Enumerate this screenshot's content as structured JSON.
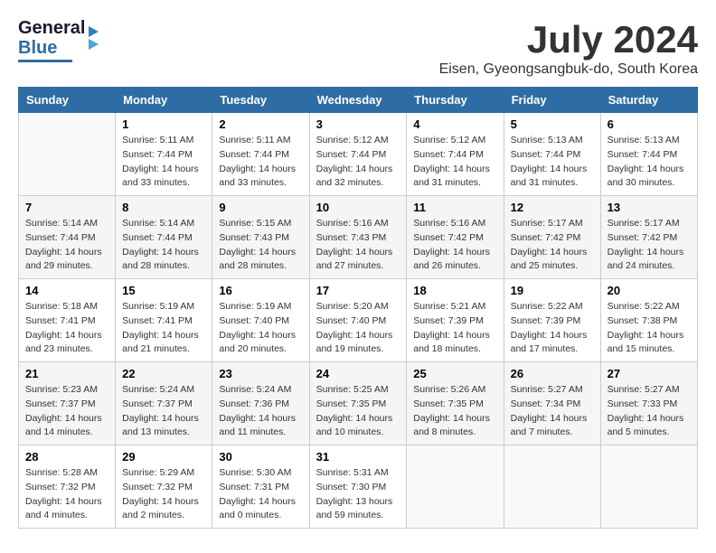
{
  "logo": {
    "line1": "General",
    "line2": "Blue"
  },
  "header": {
    "month_year": "July 2024",
    "location": "Eisen, Gyeongsangbuk-do, South Korea"
  },
  "days_of_week": [
    "Sunday",
    "Monday",
    "Tuesday",
    "Wednesday",
    "Thursday",
    "Friday",
    "Saturday"
  ],
  "weeks": [
    [
      {
        "day": "",
        "sunrise": "",
        "sunset": "",
        "daylight": ""
      },
      {
        "day": "1",
        "sunrise": "Sunrise: 5:11 AM",
        "sunset": "Sunset: 7:44 PM",
        "daylight": "Daylight: 14 hours and 33 minutes."
      },
      {
        "day": "2",
        "sunrise": "Sunrise: 5:11 AM",
        "sunset": "Sunset: 7:44 PM",
        "daylight": "Daylight: 14 hours and 33 minutes."
      },
      {
        "day": "3",
        "sunrise": "Sunrise: 5:12 AM",
        "sunset": "Sunset: 7:44 PM",
        "daylight": "Daylight: 14 hours and 32 minutes."
      },
      {
        "day": "4",
        "sunrise": "Sunrise: 5:12 AM",
        "sunset": "Sunset: 7:44 PM",
        "daylight": "Daylight: 14 hours and 31 minutes."
      },
      {
        "day": "5",
        "sunrise": "Sunrise: 5:13 AM",
        "sunset": "Sunset: 7:44 PM",
        "daylight": "Daylight: 14 hours and 31 minutes."
      },
      {
        "day": "6",
        "sunrise": "Sunrise: 5:13 AM",
        "sunset": "Sunset: 7:44 PM",
        "daylight": "Daylight: 14 hours and 30 minutes."
      }
    ],
    [
      {
        "day": "7",
        "sunrise": "Sunrise: 5:14 AM",
        "sunset": "Sunset: 7:44 PM",
        "daylight": "Daylight: 14 hours and 29 minutes."
      },
      {
        "day": "8",
        "sunrise": "Sunrise: 5:14 AM",
        "sunset": "Sunset: 7:44 PM",
        "daylight": "Daylight: 14 hours and 28 minutes."
      },
      {
        "day": "9",
        "sunrise": "Sunrise: 5:15 AM",
        "sunset": "Sunset: 7:43 PM",
        "daylight": "Daylight: 14 hours and 28 minutes."
      },
      {
        "day": "10",
        "sunrise": "Sunrise: 5:16 AM",
        "sunset": "Sunset: 7:43 PM",
        "daylight": "Daylight: 14 hours and 27 minutes."
      },
      {
        "day": "11",
        "sunrise": "Sunrise: 5:16 AM",
        "sunset": "Sunset: 7:42 PM",
        "daylight": "Daylight: 14 hours and 26 minutes."
      },
      {
        "day": "12",
        "sunrise": "Sunrise: 5:17 AM",
        "sunset": "Sunset: 7:42 PM",
        "daylight": "Daylight: 14 hours and 25 minutes."
      },
      {
        "day": "13",
        "sunrise": "Sunrise: 5:17 AM",
        "sunset": "Sunset: 7:42 PM",
        "daylight": "Daylight: 14 hours and 24 minutes."
      }
    ],
    [
      {
        "day": "14",
        "sunrise": "Sunrise: 5:18 AM",
        "sunset": "Sunset: 7:41 PM",
        "daylight": "Daylight: 14 hours and 23 minutes."
      },
      {
        "day": "15",
        "sunrise": "Sunrise: 5:19 AM",
        "sunset": "Sunset: 7:41 PM",
        "daylight": "Daylight: 14 hours and 21 minutes."
      },
      {
        "day": "16",
        "sunrise": "Sunrise: 5:19 AM",
        "sunset": "Sunset: 7:40 PM",
        "daylight": "Daylight: 14 hours and 20 minutes."
      },
      {
        "day": "17",
        "sunrise": "Sunrise: 5:20 AM",
        "sunset": "Sunset: 7:40 PM",
        "daylight": "Daylight: 14 hours and 19 minutes."
      },
      {
        "day": "18",
        "sunrise": "Sunrise: 5:21 AM",
        "sunset": "Sunset: 7:39 PM",
        "daylight": "Daylight: 14 hours and 18 minutes."
      },
      {
        "day": "19",
        "sunrise": "Sunrise: 5:22 AM",
        "sunset": "Sunset: 7:39 PM",
        "daylight": "Daylight: 14 hours and 17 minutes."
      },
      {
        "day": "20",
        "sunrise": "Sunrise: 5:22 AM",
        "sunset": "Sunset: 7:38 PM",
        "daylight": "Daylight: 14 hours and 15 minutes."
      }
    ],
    [
      {
        "day": "21",
        "sunrise": "Sunrise: 5:23 AM",
        "sunset": "Sunset: 7:37 PM",
        "daylight": "Daylight: 14 hours and 14 minutes."
      },
      {
        "day": "22",
        "sunrise": "Sunrise: 5:24 AM",
        "sunset": "Sunset: 7:37 PM",
        "daylight": "Daylight: 14 hours and 13 minutes."
      },
      {
        "day": "23",
        "sunrise": "Sunrise: 5:24 AM",
        "sunset": "Sunset: 7:36 PM",
        "daylight": "Daylight: 14 hours and 11 minutes."
      },
      {
        "day": "24",
        "sunrise": "Sunrise: 5:25 AM",
        "sunset": "Sunset: 7:35 PM",
        "daylight": "Daylight: 14 hours and 10 minutes."
      },
      {
        "day": "25",
        "sunrise": "Sunrise: 5:26 AM",
        "sunset": "Sunset: 7:35 PM",
        "daylight": "Daylight: 14 hours and 8 minutes."
      },
      {
        "day": "26",
        "sunrise": "Sunrise: 5:27 AM",
        "sunset": "Sunset: 7:34 PM",
        "daylight": "Daylight: 14 hours and 7 minutes."
      },
      {
        "day": "27",
        "sunrise": "Sunrise: 5:27 AM",
        "sunset": "Sunset: 7:33 PM",
        "daylight": "Daylight: 14 hours and 5 minutes."
      }
    ],
    [
      {
        "day": "28",
        "sunrise": "Sunrise: 5:28 AM",
        "sunset": "Sunset: 7:32 PM",
        "daylight": "Daylight: 14 hours and 4 minutes."
      },
      {
        "day": "29",
        "sunrise": "Sunrise: 5:29 AM",
        "sunset": "Sunset: 7:32 PM",
        "daylight": "Daylight: 14 hours and 2 minutes."
      },
      {
        "day": "30",
        "sunrise": "Sunrise: 5:30 AM",
        "sunset": "Sunset: 7:31 PM",
        "daylight": "Daylight: 14 hours and 0 minutes."
      },
      {
        "day": "31",
        "sunrise": "Sunrise: 5:31 AM",
        "sunset": "Sunset: 7:30 PM",
        "daylight": "Daylight: 13 hours and 59 minutes."
      },
      {
        "day": "",
        "sunrise": "",
        "sunset": "",
        "daylight": ""
      },
      {
        "day": "",
        "sunrise": "",
        "sunset": "",
        "daylight": ""
      },
      {
        "day": "",
        "sunrise": "",
        "sunset": "",
        "daylight": ""
      }
    ]
  ]
}
